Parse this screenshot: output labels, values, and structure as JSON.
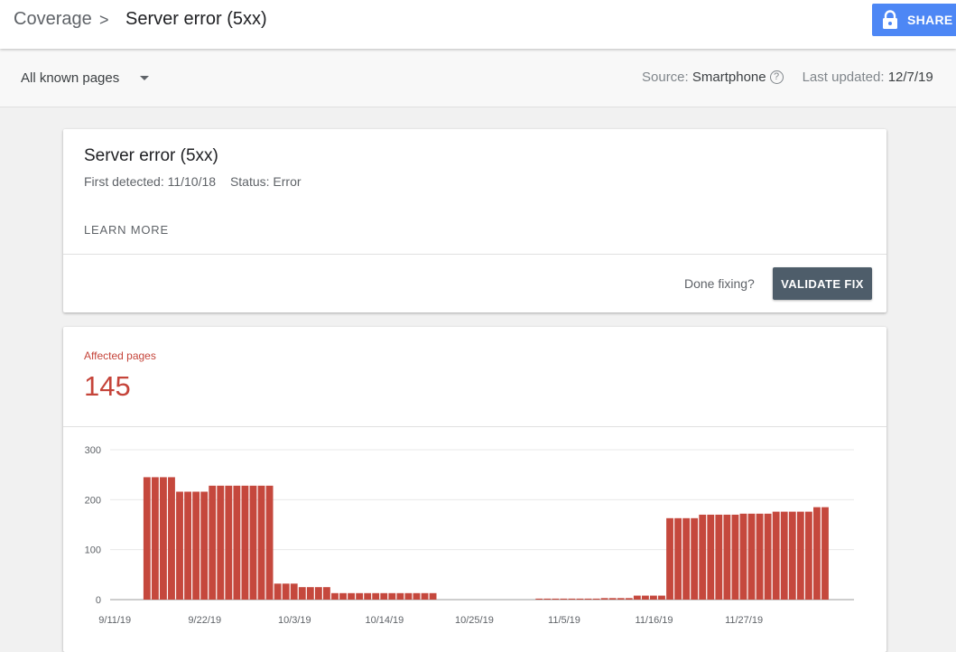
{
  "header": {
    "breadcrumb_root": "Coverage",
    "breadcrumb_separator": ">",
    "breadcrumb_current": "Server error (5xx)",
    "share_label": "SHARE",
    "share_icon": "lock-icon",
    "share_color": "#4d87f5"
  },
  "filter": {
    "selected": "All known pages",
    "source_label": "Source:",
    "source_value": "Smartphone",
    "help_icon": "?",
    "updated_label": "Last updated:",
    "updated_value": "12/7/19"
  },
  "issue": {
    "title": "Server error (5xx)",
    "first_detected": "First detected: 11/10/18",
    "status": "Status: Error",
    "learn_more": "LEARN MORE",
    "done_fixing": "Done fixing?",
    "validate_label": "VALIDATE FIX",
    "validate_color": "#4e5d6a"
  },
  "affected": {
    "label": "Affected pages",
    "value": "145",
    "accent_color": "#c5443a"
  },
  "chart_data": {
    "type": "bar",
    "color": "#c5483d",
    "ylim": [
      0,
      300
    ],
    "yticks": [
      0,
      100,
      200,
      300
    ],
    "xtick_labels": [
      "9/11/19",
      "9/22/19",
      "10/3/19",
      "10/14/19",
      "10/25/19",
      "11/5/19",
      "11/16/19",
      "11/27/19"
    ],
    "categories": [
      "9/11/19",
      "9/12/19",
      "9/13/19",
      "9/14/19",
      "9/15/19",
      "9/16/19",
      "9/17/19",
      "9/18/19",
      "9/19/19",
      "9/20/19",
      "9/21/19",
      "9/22/19",
      "9/23/19",
      "9/24/19",
      "9/25/19",
      "9/26/19",
      "9/27/19",
      "9/28/19",
      "9/29/19",
      "9/30/19",
      "10/1/19",
      "10/2/19",
      "10/3/19",
      "10/4/19",
      "10/5/19",
      "10/6/19",
      "10/7/19",
      "10/8/19",
      "10/9/19",
      "10/10/19",
      "10/11/19",
      "10/12/19",
      "10/13/19",
      "10/14/19",
      "10/15/19",
      "10/16/19",
      "10/17/19",
      "10/18/19",
      "10/19/19",
      "10/20/19",
      "10/21/19",
      "10/22/19",
      "10/23/19",
      "10/24/19",
      "10/25/19",
      "10/26/19",
      "10/27/19",
      "10/28/19",
      "10/29/19",
      "10/30/19",
      "10/31/19",
      "11/1/19",
      "11/2/19",
      "11/3/19",
      "11/4/19",
      "11/5/19",
      "11/6/19",
      "11/7/19",
      "11/8/19",
      "11/9/19",
      "11/10/19",
      "11/11/19",
      "11/12/19",
      "11/13/19",
      "11/14/19",
      "11/15/19",
      "11/16/19",
      "11/17/19",
      "11/18/19",
      "11/19/19",
      "11/20/19",
      "11/21/19",
      "11/22/19",
      "11/23/19",
      "11/24/19",
      "11/25/19",
      "11/26/19",
      "11/27/19",
      "11/28/19",
      "11/29/19",
      "11/30/19",
      "12/1/19",
      "12/2/19",
      "12/3/19",
      "12/4/19",
      "12/5/19",
      "12/6/19",
      "12/7/19"
    ],
    "values": [
      0,
      0,
      0,
      0,
      245,
      245,
      245,
      245,
      216,
      216,
      216,
      216,
      228,
      228,
      228,
      228,
      228,
      228,
      228,
      228,
      32,
      32,
      32,
      25,
      25,
      25,
      25,
      13,
      13,
      13,
      13,
      13,
      13,
      13,
      13,
      13,
      13,
      13,
      13,
      13,
      0,
      0,
      0,
      0,
      0,
      0,
      0,
      0,
      0,
      0,
      0,
      0,
      2,
      2,
      2,
      2,
      2,
      2,
      2,
      2,
      3,
      3,
      3,
      3,
      8,
      8,
      8,
      8,
      163,
      163,
      163,
      163,
      170,
      170,
      170,
      170,
      170,
      172,
      172,
      172,
      172,
      176,
      176,
      176,
      176,
      176,
      185,
      185
    ]
  }
}
